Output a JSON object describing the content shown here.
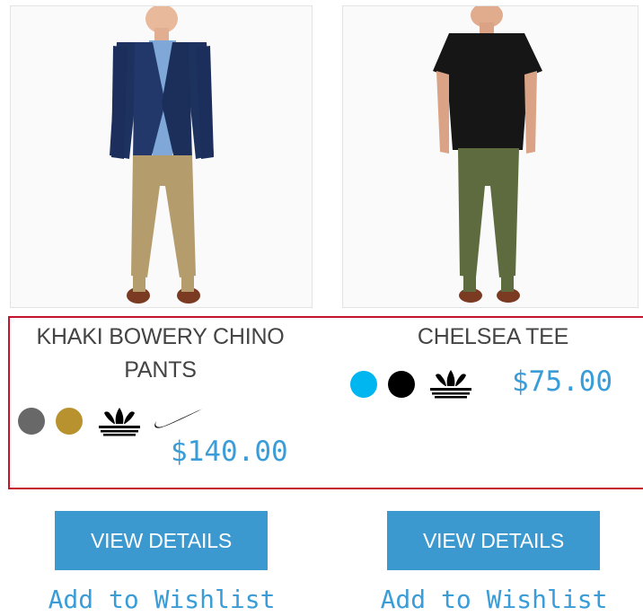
{
  "products": [
    {
      "name": "KHAKI BOWERY CHINO PANTS",
      "swatches": [
        "#686868",
        "#b8922e",
        "adidas-logo-icon",
        "nike-logo-icon"
      ],
      "price": "$140.00",
      "view_details": "VIEW DETAILS",
      "wishlist": "Add to Wishlist"
    },
    {
      "name": "CHELSEA TEE",
      "swatches": [
        "#00b6f0",
        "#000000",
        "adidas-logo-icon"
      ],
      "price": "$75.00",
      "view_details": "VIEW DETAILS",
      "wishlist": "Add to Wishlist"
    }
  ],
  "colors": {
    "accent": "#3c99d0",
    "price_text": "#3a9dd8",
    "highlight_border": "#c4142c"
  }
}
